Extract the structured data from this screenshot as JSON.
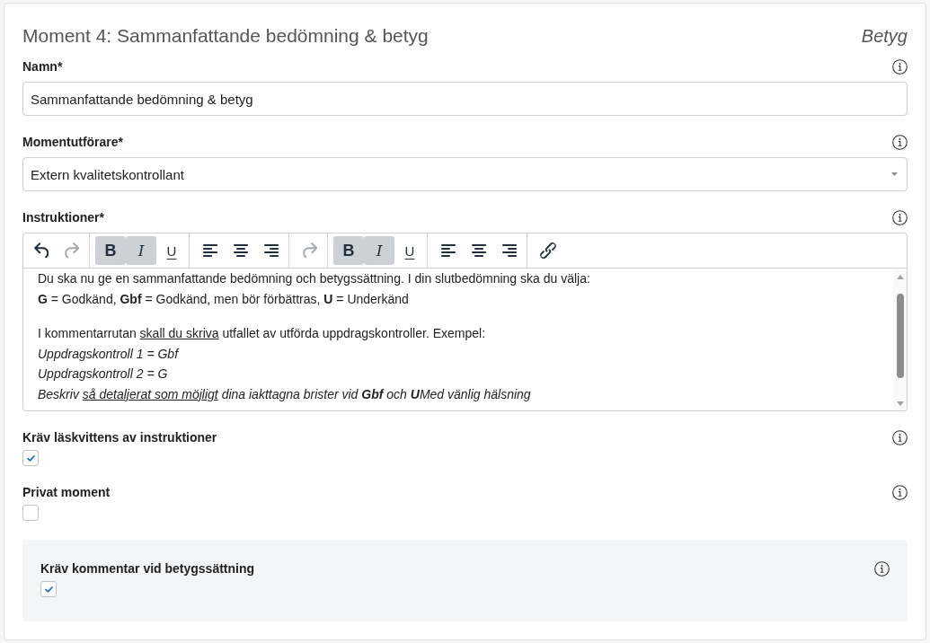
{
  "header": {
    "title": "Moment 4: Sammanfattande bedömning & betyg",
    "category": "Betyg"
  },
  "fields": [
    {
      "kind": "text",
      "label": "Namn*",
      "value": "Sammanfattande bedömning & betyg"
    },
    {
      "kind": "select",
      "label": "Momentutförare*",
      "value": "Extern kvalitetskontrollant"
    },
    {
      "kind": "editor",
      "label": "Instruktioner*",
      "toolbar": [
        [
          {
            "kind": "undo",
            "disabled": false
          },
          {
            "kind": "redo",
            "disabled": true
          }
        ],
        [
          {
            "kind": "bold",
            "label": "B",
            "active": true,
            "disabled": false
          },
          {
            "kind": "italic",
            "label": "I",
            "active": true,
            "disabled": false
          },
          {
            "kind": "underline",
            "label": "U",
            "active": false,
            "disabled": false
          }
        ],
        [
          {
            "kind": "align-left",
            "disabled": false
          },
          {
            "kind": "align-center",
            "disabled": false
          },
          {
            "kind": "align-right",
            "disabled": false
          }
        ],
        [
          {
            "kind": "redo",
            "disabled": true
          }
        ],
        [
          {
            "kind": "bold",
            "label": "B",
            "active": true,
            "disabled": false
          },
          {
            "kind": "italic",
            "label": "I",
            "active": true,
            "disabled": false
          },
          {
            "kind": "underline",
            "label": "U",
            "active": false,
            "disabled": false
          }
        ],
        [
          {
            "kind": "align-left",
            "disabled": false
          },
          {
            "kind": "align-center",
            "disabled": false
          },
          {
            "kind": "align-right",
            "disabled": false
          }
        ],
        [
          {
            "kind": "link",
            "disabled": false
          }
        ]
      ],
      "content": [
        [
          {
            "italic": false,
            "parts": [
              {
                "text": "Du ska nu ge en sammanfattande bedömning och betygssättning. I din slutbedömning ska du välja:",
                "underline": false
              }
            ]
          },
          {
            "italic": false,
            "parts": [
              {
                "text": "**G** = Godkänd, **Gbf** = Godkänd, men bör förbättras, **U** = Underkänd",
                "underline": false
              }
            ]
          }
        ],
        [
          {
            "italic": false,
            "parts": [
              {
                "text": "I kommentarrutan ",
                "underline": false
              },
              {
                "text": "skall du skriva",
                "underline": true
              },
              {
                "text": " utfallet av utförda uppdragskontroller. Exempel:",
                "underline": false
              }
            ]
          },
          {
            "italic": true,
            "parts": [
              {
                "text": "Uppdragskontroll 1 = Gbf",
                "underline": false
              }
            ]
          },
          {
            "italic": true,
            "parts": [
              {
                "text": "Uppdragskontroll 2 = G",
                "underline": false
              }
            ]
          },
          {
            "italic": true,
            "parts": [
              {
                "text": "Beskriv ",
                "underline": false
              },
              {
                "text": "så detaljerat som möjligt",
                "underline": true
              },
              {
                "text": " dina iakttagna brister vid **Gbf** och **U**Med vänlig hälsning",
                "underline": false
              }
            ]
          }
        ]
      ]
    },
    {
      "kind": "checkbox",
      "label": "Kräv läskvittens av instruktioner",
      "checked": true
    },
    {
      "kind": "checkbox",
      "label": "Privat moment",
      "checked": false
    }
  ],
  "panel": {
    "fields": [
      {
        "kind": "checkbox",
        "label": "Kräv kommentar vid betygssättning",
        "checked": true
      }
    ]
  }
}
